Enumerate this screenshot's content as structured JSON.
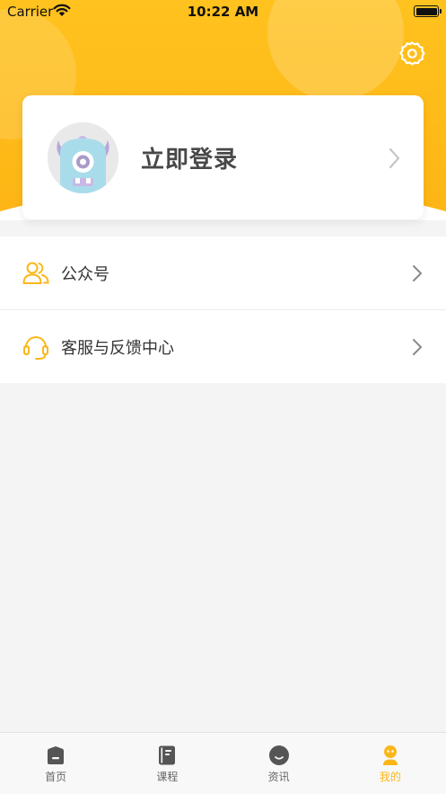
{
  "status_bar": {
    "carrier": "Carrier",
    "time": "10:22 AM"
  },
  "header": {
    "settings_icon": "gear-icon"
  },
  "login_card": {
    "login_text": "立即登录",
    "avatar_icon": "monster-avatar-icon",
    "chevron_icon": "chevron-right-icon"
  },
  "menu": [
    {
      "label": "公众号",
      "icon": "users-icon"
    },
    {
      "label": "客服与反馈中心",
      "icon": "headset-icon"
    }
  ],
  "tabs": [
    {
      "label": "首页",
      "icon": "home-icon",
      "active": false
    },
    {
      "label": "课程",
      "icon": "book-icon",
      "active": false
    },
    {
      "label": "资讯",
      "icon": "news-icon",
      "active": false
    },
    {
      "label": "我的",
      "icon": "profile-icon",
      "active": true
    }
  ],
  "colors": {
    "accent": "#fbb71a",
    "header_yellow": "#ffc21f",
    "inactive_icon": "#555555",
    "page_background": "#f4f4f4"
  }
}
